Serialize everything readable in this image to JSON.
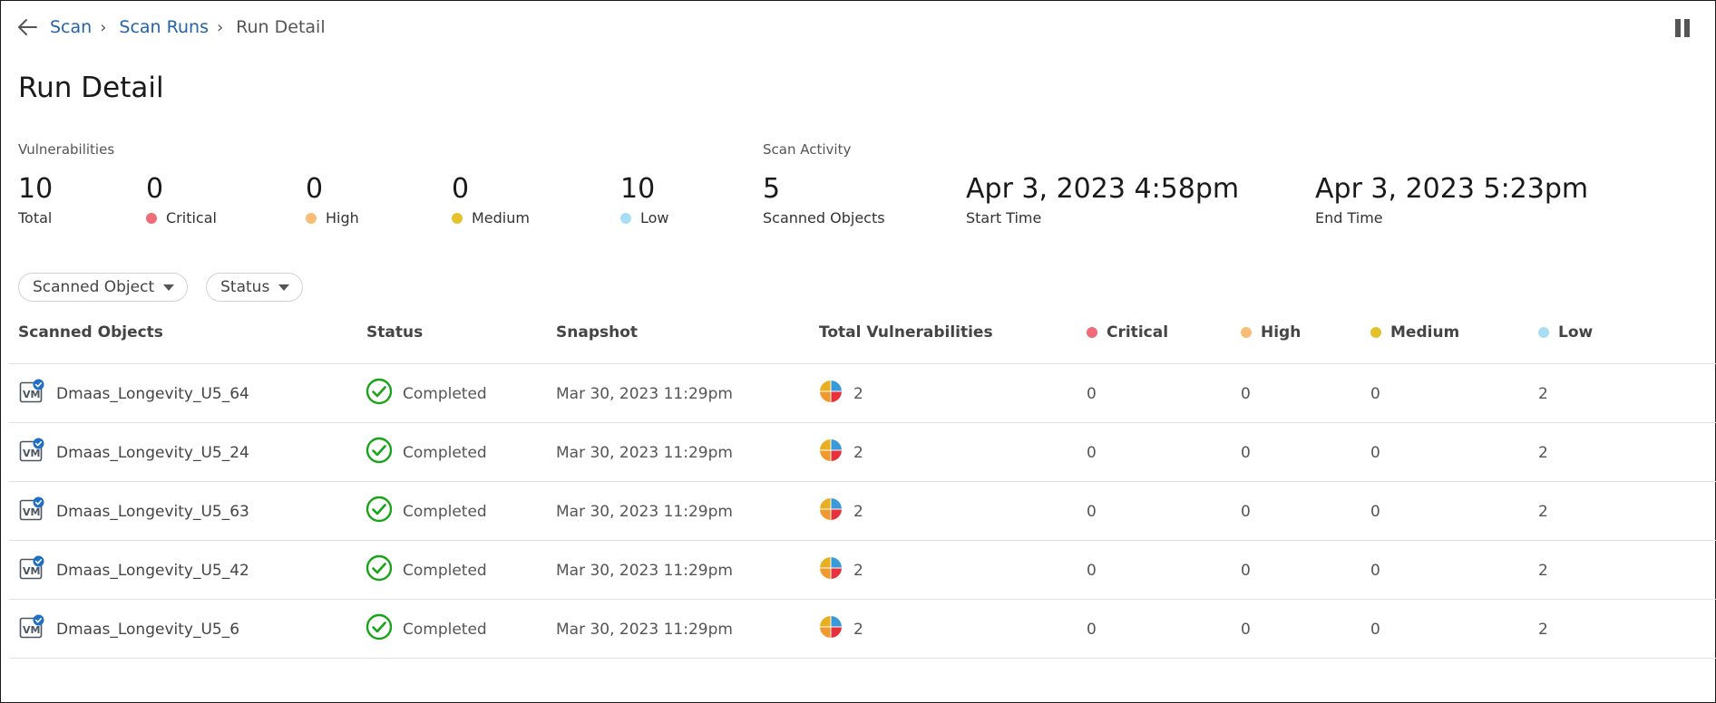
{
  "breadcrumb": {
    "items": [
      "Scan",
      "Scan Runs"
    ],
    "current": "Run Detail",
    "separator": "›"
  },
  "page_title": "Run Detail",
  "vulnerabilities": {
    "label": "Vulnerabilities",
    "total": {
      "value": "10",
      "label": "Total"
    },
    "critical": {
      "value": "0",
      "label": "Critical",
      "color": "#ee6b77"
    },
    "high": {
      "value": "0",
      "label": "High",
      "color": "#f9bd75"
    },
    "medium": {
      "value": "0",
      "label": "Medium",
      "color": "#e5c12b"
    },
    "low": {
      "value": "10",
      "label": "Low",
      "color": "#a8ddf5"
    }
  },
  "scan_activity": {
    "label": "Scan Activity",
    "scanned_objects": {
      "value": "5",
      "label": "Scanned Objects"
    },
    "start_time": {
      "value": "Apr 3, 2023 4:58pm",
      "label": "Start Time"
    },
    "end_time": {
      "value": "Apr 3, 2023 5:23pm",
      "label": "End Time"
    }
  },
  "filters": [
    "Scanned Object",
    "Status"
  ],
  "table": {
    "headers": {
      "object": "Scanned Objects",
      "status": "Status",
      "snapshot": "Snapshot",
      "total": "Total Vulnerabilities",
      "critical": "Critical",
      "high": "High",
      "medium": "Medium",
      "low": "Low"
    },
    "rows": [
      {
        "object": "Dmaas_Longevity_U5_64",
        "status": "Completed",
        "snapshot": "Mar 30, 2023 11:29pm",
        "total": "2",
        "critical": "0",
        "high": "0",
        "medium": "0",
        "low": "2"
      },
      {
        "object": "Dmaas_Longevity_U5_24",
        "status": "Completed",
        "snapshot": "Mar 30, 2023 11:29pm",
        "total": "2",
        "critical": "0",
        "high": "0",
        "medium": "0",
        "low": "2"
      },
      {
        "object": "Dmaas_Longevity_U5_63",
        "status": "Completed",
        "snapshot": "Mar 30, 2023 11:29pm",
        "total": "2",
        "critical": "0",
        "high": "0",
        "medium": "0",
        "low": "2"
      },
      {
        "object": "Dmaas_Longevity_U5_42",
        "status": "Completed",
        "snapshot": "Mar 30, 2023 11:29pm",
        "total": "2",
        "critical": "0",
        "high": "0",
        "medium": "0",
        "low": "2"
      },
      {
        "object": "Dmaas_Longevity_U5_6",
        "status": "Completed",
        "snapshot": "Mar 30, 2023 11:29pm",
        "total": "2",
        "critical": "0",
        "high": "0",
        "medium": "0",
        "low": "2"
      }
    ]
  },
  "icons": {
    "back": "arrow-left-icon",
    "pause": "pause-icon",
    "vm": "vm-protected-icon",
    "status": "check-circle-icon",
    "pie": "severity-pie-icon",
    "filter_caret": "caret-down-icon"
  },
  "colors": {
    "link": "#2563a8",
    "success": "#18a318",
    "pie_blue": "#3a9ad9",
    "pie_red": "#e8313a",
    "pie_orange": "#f2992e",
    "pie_yellow": "#e8b020"
  }
}
